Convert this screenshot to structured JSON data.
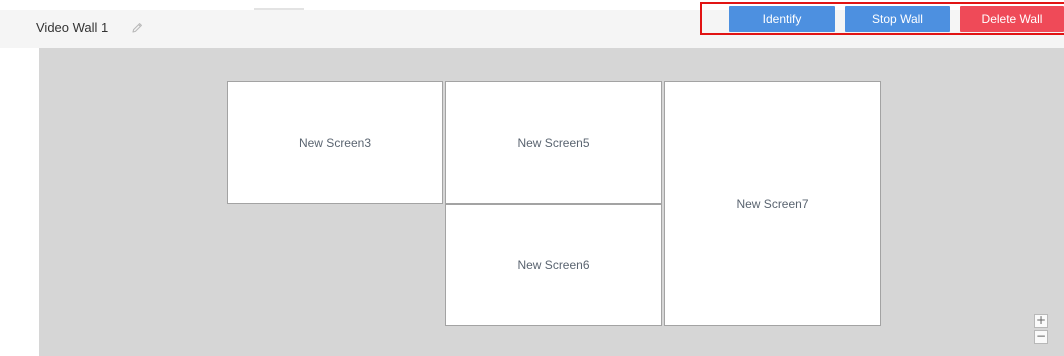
{
  "wall": {
    "title": "Video Wall 1",
    "edit_icon": "pencil-icon"
  },
  "toolbar": {
    "identify_label": "Identify",
    "stop_label": "Stop Wall",
    "delete_label": "Delete Wall",
    "highlight_color": "#e11414",
    "primary_color": "#4d90e0",
    "danger_color": "#ef4a58"
  },
  "screens": [
    {
      "label": "New Screen3"
    },
    {
      "label": "New Screen5"
    },
    {
      "label": "New Screen6"
    },
    {
      "label": "New Screen7"
    }
  ],
  "zoom": {
    "in_label": "+",
    "out_label": "−"
  }
}
